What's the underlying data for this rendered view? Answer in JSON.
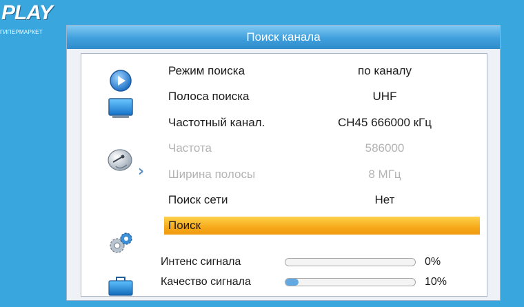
{
  "brand": {
    "logo_text": "PLAY",
    "logo_sub": "ГИПЕРМАРКЕТ"
  },
  "window": {
    "title": "Поиск канала"
  },
  "sidebar": {
    "items": [
      {
        "icon": "play-icon"
      },
      {
        "icon": "tv-monitor-icon"
      },
      {
        "icon": "satellite-dish-icon",
        "selected": true
      },
      {
        "icon": "gears-settings-icon"
      },
      {
        "icon": "toolbox-icon"
      }
    ],
    "selected_arrow": "›"
  },
  "settings": {
    "rows": [
      {
        "label": "Режим поиска",
        "value": "по каналу",
        "enabled": true
      },
      {
        "label": "Полоса поиска",
        "value": "UHF",
        "enabled": true
      },
      {
        "label": "Частотный канал.",
        "value": "CH45 666000 кГц",
        "enabled": true
      },
      {
        "label": "Частота",
        "value": "586000",
        "enabled": false
      },
      {
        "label": "Ширина полосы",
        "value": "8 МГц",
        "enabled": false
      },
      {
        "label": "Поиск сети",
        "value": "Нет",
        "enabled": true
      }
    ],
    "search_button": "Поиск"
  },
  "signal": {
    "intensity_label": "Интенс сигнала",
    "intensity_value": "0%",
    "intensity_fraction": 0.0,
    "quality_label": "Качество сигнала",
    "quality_value": "10%",
    "quality_fraction": 0.1
  },
  "colors": {
    "highlight": "#f6a91a",
    "titlebar": "#3f9fdc",
    "disabled_text": "#b3b3b3"
  }
}
